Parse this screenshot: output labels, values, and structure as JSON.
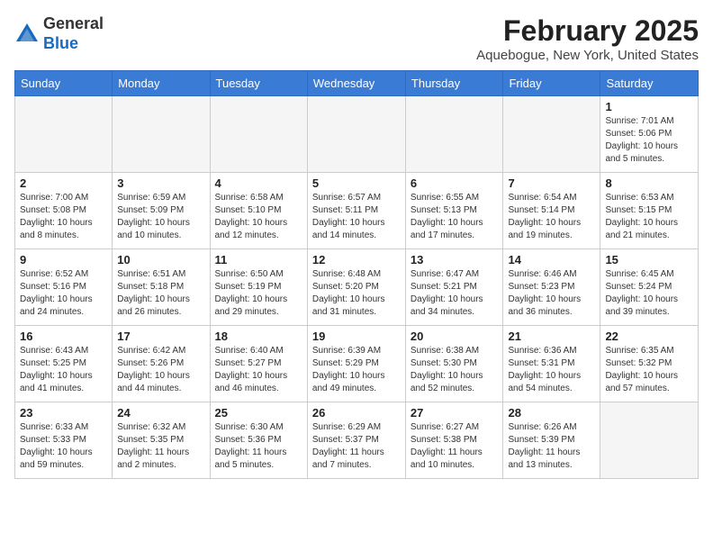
{
  "header": {
    "logo_general": "General",
    "logo_blue": "Blue",
    "month_title": "February 2025",
    "location": "Aquebogue, New York, United States"
  },
  "weekdays": [
    "Sunday",
    "Monday",
    "Tuesday",
    "Wednesday",
    "Thursday",
    "Friday",
    "Saturday"
  ],
  "weeks": [
    [
      {
        "day": "",
        "info": ""
      },
      {
        "day": "",
        "info": ""
      },
      {
        "day": "",
        "info": ""
      },
      {
        "day": "",
        "info": ""
      },
      {
        "day": "",
        "info": ""
      },
      {
        "day": "",
        "info": ""
      },
      {
        "day": "1",
        "info": "Sunrise: 7:01 AM\nSunset: 5:06 PM\nDaylight: 10 hours\nand 5 minutes."
      }
    ],
    [
      {
        "day": "2",
        "info": "Sunrise: 7:00 AM\nSunset: 5:08 PM\nDaylight: 10 hours\nand 8 minutes."
      },
      {
        "day": "3",
        "info": "Sunrise: 6:59 AM\nSunset: 5:09 PM\nDaylight: 10 hours\nand 10 minutes."
      },
      {
        "day": "4",
        "info": "Sunrise: 6:58 AM\nSunset: 5:10 PM\nDaylight: 10 hours\nand 12 minutes."
      },
      {
        "day": "5",
        "info": "Sunrise: 6:57 AM\nSunset: 5:11 PM\nDaylight: 10 hours\nand 14 minutes."
      },
      {
        "day": "6",
        "info": "Sunrise: 6:55 AM\nSunset: 5:13 PM\nDaylight: 10 hours\nand 17 minutes."
      },
      {
        "day": "7",
        "info": "Sunrise: 6:54 AM\nSunset: 5:14 PM\nDaylight: 10 hours\nand 19 minutes."
      },
      {
        "day": "8",
        "info": "Sunrise: 6:53 AM\nSunset: 5:15 PM\nDaylight: 10 hours\nand 21 minutes."
      }
    ],
    [
      {
        "day": "9",
        "info": "Sunrise: 6:52 AM\nSunset: 5:16 PM\nDaylight: 10 hours\nand 24 minutes."
      },
      {
        "day": "10",
        "info": "Sunrise: 6:51 AM\nSunset: 5:18 PM\nDaylight: 10 hours\nand 26 minutes."
      },
      {
        "day": "11",
        "info": "Sunrise: 6:50 AM\nSunset: 5:19 PM\nDaylight: 10 hours\nand 29 minutes."
      },
      {
        "day": "12",
        "info": "Sunrise: 6:48 AM\nSunset: 5:20 PM\nDaylight: 10 hours\nand 31 minutes."
      },
      {
        "day": "13",
        "info": "Sunrise: 6:47 AM\nSunset: 5:21 PM\nDaylight: 10 hours\nand 34 minutes."
      },
      {
        "day": "14",
        "info": "Sunrise: 6:46 AM\nSunset: 5:23 PM\nDaylight: 10 hours\nand 36 minutes."
      },
      {
        "day": "15",
        "info": "Sunrise: 6:45 AM\nSunset: 5:24 PM\nDaylight: 10 hours\nand 39 minutes."
      }
    ],
    [
      {
        "day": "16",
        "info": "Sunrise: 6:43 AM\nSunset: 5:25 PM\nDaylight: 10 hours\nand 41 minutes."
      },
      {
        "day": "17",
        "info": "Sunrise: 6:42 AM\nSunset: 5:26 PM\nDaylight: 10 hours\nand 44 minutes."
      },
      {
        "day": "18",
        "info": "Sunrise: 6:40 AM\nSunset: 5:27 PM\nDaylight: 10 hours\nand 46 minutes."
      },
      {
        "day": "19",
        "info": "Sunrise: 6:39 AM\nSunset: 5:29 PM\nDaylight: 10 hours\nand 49 minutes."
      },
      {
        "day": "20",
        "info": "Sunrise: 6:38 AM\nSunset: 5:30 PM\nDaylight: 10 hours\nand 52 minutes."
      },
      {
        "day": "21",
        "info": "Sunrise: 6:36 AM\nSunset: 5:31 PM\nDaylight: 10 hours\nand 54 minutes."
      },
      {
        "day": "22",
        "info": "Sunrise: 6:35 AM\nSunset: 5:32 PM\nDaylight: 10 hours\nand 57 minutes."
      }
    ],
    [
      {
        "day": "23",
        "info": "Sunrise: 6:33 AM\nSunset: 5:33 PM\nDaylight: 10 hours\nand 59 minutes."
      },
      {
        "day": "24",
        "info": "Sunrise: 6:32 AM\nSunset: 5:35 PM\nDaylight: 11 hours\nand 2 minutes."
      },
      {
        "day": "25",
        "info": "Sunrise: 6:30 AM\nSunset: 5:36 PM\nDaylight: 11 hours\nand 5 minutes."
      },
      {
        "day": "26",
        "info": "Sunrise: 6:29 AM\nSunset: 5:37 PM\nDaylight: 11 hours\nand 7 minutes."
      },
      {
        "day": "27",
        "info": "Sunrise: 6:27 AM\nSunset: 5:38 PM\nDaylight: 11 hours\nand 10 minutes."
      },
      {
        "day": "28",
        "info": "Sunrise: 6:26 AM\nSunset: 5:39 PM\nDaylight: 11 hours\nand 13 minutes."
      },
      {
        "day": "",
        "info": ""
      }
    ]
  ]
}
